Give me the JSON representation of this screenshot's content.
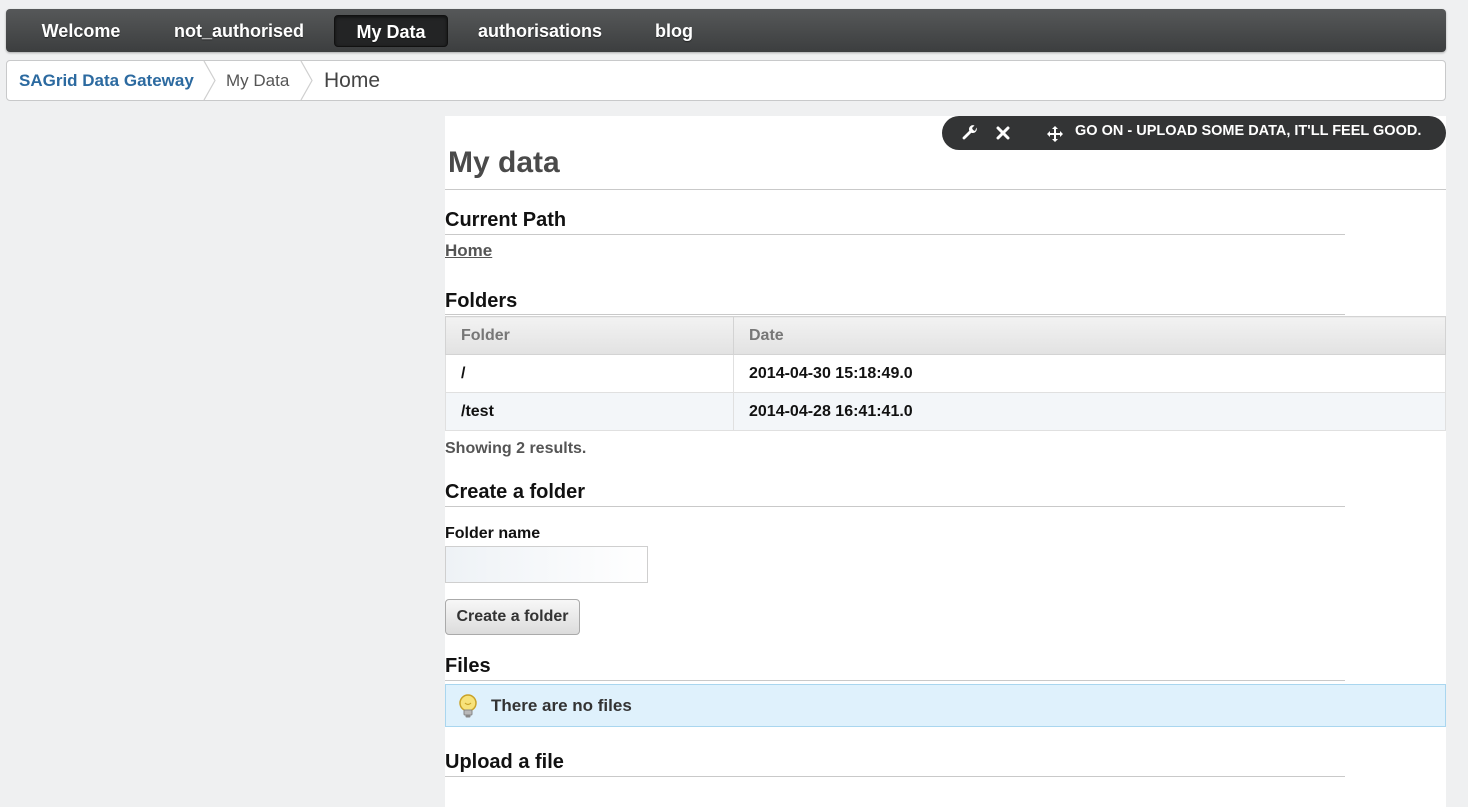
{
  "nav": {
    "items": [
      {
        "label": "Welcome",
        "active": false
      },
      {
        "label": "not_authorised",
        "active": false
      },
      {
        "label": "My Data",
        "active": true
      },
      {
        "label": "authorisations",
        "active": false
      },
      {
        "label": "blog",
        "active": false
      }
    ]
  },
  "breadcrumb": [
    "SAGrid Data Gateway",
    "My Data",
    "Home"
  ],
  "toolbar": {
    "message": "GO ON - UPLOAD SOME DATA, IT'LL FEEL GOOD.",
    "icons": [
      "wrench-icon",
      "close-icon",
      "move-icon"
    ]
  },
  "page": {
    "title": "My data",
    "current_path_heading": "Current Path",
    "current_path_link": "Home",
    "folders_heading": "Folders",
    "folders_table": {
      "columns": [
        "Folder",
        "Date"
      ],
      "rows": [
        [
          "/",
          "2014-04-30 15:18:49.0"
        ],
        [
          "/test",
          "2014-04-28 16:41:41.0"
        ]
      ]
    },
    "summary": "Showing 2 results.",
    "create_heading": "Create a folder",
    "folder_name_label": "Folder name",
    "folder_name_value": "",
    "create_button": "Create a folder",
    "files_heading": "Files",
    "files_empty": "There are no files",
    "upload_heading": "Upload a file"
  },
  "colors": {
    "nav_bg": "#4a4c4d",
    "link_blue": "#2c6aa0",
    "info_bg": "#dff1fc"
  }
}
